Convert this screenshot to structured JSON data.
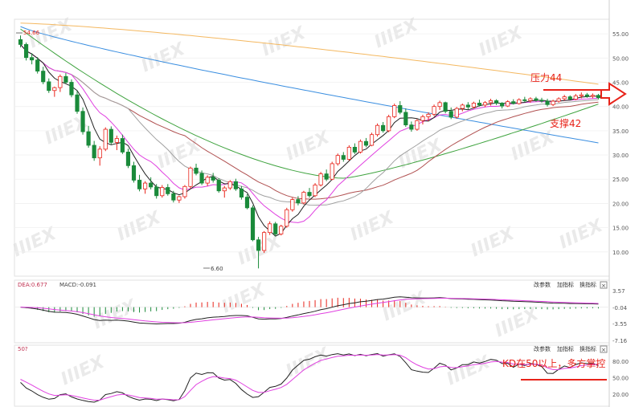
{
  "chart_data": [
    {
      "type": "candlestick",
      "ylim": [
        5,
        58
      ],
      "yticks": [
        "55.00",
        "50.00",
        "45.00",
        "40.00",
        "35.00",
        "30.00",
        "25.00",
        "20.00",
        "15.00",
        "10.00"
      ],
      "high_label": "54.66",
      "low_label": "6.60",
      "ohlc": [
        [
          53.8,
          54.66,
          52.2,
          52.8
        ],
        [
          52.8,
          53.2,
          49.5,
          50.1
        ],
        [
          50.1,
          51.0,
          48.7,
          49.6
        ],
        [
          49.6,
          50.2,
          46.8,
          47.3
        ],
        [
          47.3,
          48.2,
          44.6,
          45.1
        ],
        [
          45.1,
          45.8,
          42.8,
          43.3
        ],
        [
          43.3,
          44.1,
          42.0,
          43.9
        ],
        [
          43.9,
          46.6,
          43.0,
          46.2
        ],
        [
          46.2,
          46.9,
          44.7,
          45.0
        ],
        [
          45.0,
          45.6,
          41.9,
          42.4
        ],
        [
          42.4,
          43.2,
          38.5,
          39.0
        ],
        [
          39.0,
          39.8,
          34.2,
          34.8
        ],
        [
          34.8,
          36.0,
          31.5,
          32.0
        ],
        [
          32.0,
          32.9,
          28.8,
          29.4
        ],
        [
          29.4,
          31.8,
          27.8,
          31.2
        ],
        [
          31.2,
          35.7,
          30.8,
          35.3
        ],
        [
          35.3,
          35.9,
          32.2,
          32.6
        ],
        [
          32.6,
          34.0,
          31.0,
          33.4
        ],
        [
          33.4,
          34.2,
          30.2,
          30.6
        ],
        [
          30.6,
          31.3,
          27.3,
          27.8
        ],
        [
          27.8,
          28.6,
          24.3,
          24.8
        ],
        [
          24.8,
          25.9,
          22.5,
          23.0
        ],
        [
          23.0,
          24.6,
          22.0,
          24.2
        ],
        [
          24.2,
          25.4,
          22.9,
          23.4
        ],
        [
          23.4,
          24.0,
          21.0,
          21.6
        ],
        [
          21.6,
          23.8,
          21.2,
          23.3
        ],
        [
          23.3,
          24.0,
          21.6,
          22.0
        ],
        [
          22.0,
          22.6,
          20.2,
          20.7
        ],
        [
          20.7,
          21.6,
          20.1,
          21.4
        ],
        [
          21.4,
          23.8,
          21.0,
          23.5
        ],
        [
          23.5,
          27.6,
          23.1,
          27.3
        ],
        [
          27.3,
          28.2,
          25.8,
          26.2
        ],
        [
          26.2,
          26.8,
          23.8,
          24.2
        ],
        [
          24.2,
          25.8,
          23.6,
          25.4
        ],
        [
          25.4,
          26.3,
          24.3,
          24.8
        ],
        [
          24.8,
          25.2,
          22.2,
          22.6
        ],
        [
          22.6,
          23.6,
          21.2,
          23.2
        ],
        [
          23.2,
          24.8,
          22.8,
          24.5
        ],
        [
          24.5,
          25.1,
          22.6,
          23.0
        ],
        [
          23.0,
          23.6,
          20.8,
          21.3
        ],
        [
          21.3,
          21.9,
          18.8,
          19.1
        ],
        [
          19.1,
          19.6,
          12.2,
          12.5
        ],
        [
          12.5,
          13.1,
          6.6,
          10.3
        ],
        [
          10.3,
          14.3,
          9.8,
          14.0
        ],
        [
          14.0,
          16.3,
          13.5,
          15.8
        ],
        [
          15.8,
          16.2,
          13.2,
          13.7
        ],
        [
          13.7,
          15.6,
          13.4,
          15.3
        ],
        [
          15.3,
          19.1,
          15.0,
          18.7
        ],
        [
          18.7,
          21.2,
          18.3,
          20.8
        ],
        [
          20.8,
          21.5,
          19.6,
          20.1
        ],
        [
          20.1,
          22.6,
          19.8,
          22.3
        ],
        [
          22.3,
          23.2,
          21.2,
          21.6
        ],
        [
          21.6,
          24.2,
          21.3,
          23.8
        ],
        [
          23.8,
          26.5,
          23.5,
          26.1
        ],
        [
          26.1,
          27.0,
          24.6,
          25.0
        ],
        [
          25.0,
          28.6,
          24.8,
          28.2
        ],
        [
          28.2,
          30.3,
          27.8,
          29.9
        ],
        [
          29.9,
          30.6,
          28.6,
          29.1
        ],
        [
          29.1,
          32.0,
          28.8,
          31.6
        ],
        [
          31.6,
          32.4,
          30.2,
          30.6
        ],
        [
          30.6,
          33.2,
          30.3,
          32.8
        ],
        [
          32.8,
          33.5,
          31.6,
          32.0
        ],
        [
          32.0,
          34.6,
          31.8,
          34.2
        ],
        [
          34.2,
          36.5,
          33.8,
          36.1
        ],
        [
          36.1,
          36.8,
          34.6,
          35.0
        ],
        [
          35.0,
          38.3,
          34.7,
          37.9
        ],
        [
          37.9,
          40.6,
          37.6,
          40.2
        ],
        [
          40.2,
          41.1,
          38.4,
          38.8
        ],
        [
          38.8,
          39.6,
          35.8,
          36.2
        ],
        [
          36.2,
          36.9,
          34.8,
          35.3
        ],
        [
          35.3,
          37.4,
          35.0,
          37.1
        ],
        [
          37.1,
          38.3,
          36.3,
          37.9
        ],
        [
          37.9,
          38.8,
          37.0,
          38.4
        ],
        [
          38.4,
          40.4,
          38.0,
          40.0
        ],
        [
          40.0,
          41.2,
          39.3,
          40.8
        ],
        [
          40.8,
          41.0,
          38.6,
          39.0
        ],
        [
          39.0,
          39.8,
          37.4,
          37.8
        ],
        [
          37.8,
          39.9,
          37.5,
          39.6
        ],
        [
          39.6,
          40.6,
          39.0,
          40.3
        ],
        [
          40.3,
          40.9,
          39.4,
          39.9
        ],
        [
          39.9,
          41.0,
          39.6,
          40.7
        ],
        [
          40.7,
          41.4,
          40.0,
          40.3
        ],
        [
          40.3,
          41.1,
          39.9,
          40.8
        ],
        [
          40.8,
          41.6,
          40.2,
          41.2
        ],
        [
          41.2,
          41.5,
          40.3,
          40.7
        ],
        [
          40.7,
          40.9,
          39.6,
          40.1
        ],
        [
          40.1,
          41.3,
          39.9,
          41.0
        ],
        [
          41.0,
          41.5,
          40.4,
          40.6
        ],
        [
          40.6,
          41.7,
          40.4,
          41.4
        ],
        [
          41.4,
          42.0,
          40.9,
          41.2
        ],
        [
          41.2,
          41.9,
          40.8,
          41.6
        ],
        [
          41.6,
          42.0,
          41.0,
          41.3
        ],
        [
          41.3,
          41.8,
          40.8,
          41.1
        ],
        [
          41.1,
          41.6,
          40.0,
          40.4
        ],
        [
          40.4,
          41.4,
          40.1,
          41.1
        ],
        [
          41.1,
          41.9,
          40.8,
          41.6
        ],
        [
          41.6,
          42.4,
          41.2,
          42.0
        ],
        [
          42.0,
          42.3,
          41.3,
          41.5
        ],
        [
          41.5,
          42.6,
          41.3,
          42.2
        ],
        [
          42.2,
          42.9,
          41.7,
          42.4
        ],
        [
          42.4,
          42.8,
          41.8,
          42.1
        ],
        [
          42.1,
          42.7,
          41.7,
          42.3
        ],
        [
          42.3,
          42.6,
          41.5,
          41.8
        ]
      ]
    },
    {
      "type": "bar",
      "indicator": "MACD",
      "yticks": [
        "3.57",
        "-0.04",
        "-3.55",
        "-7.16"
      ],
      "ylim": [
        -7.16,
        3.57
      ],
      "dea_label": "DEA:0.677",
      "macd_label": "MACD:-0.091"
    },
    {
      "type": "line",
      "indicator": "KD",
      "yticks": [
        "80.00",
        "50.00",
        "20.00"
      ],
      "ylim": [
        0,
        100
      ],
      "k_label": "50?"
    }
  ],
  "annotations": {
    "resistance": "压力44",
    "support": "支撑42",
    "kd_note": "KD在50以上，多方掌控"
  },
  "buttons": {
    "params": "改参数",
    "add": "加指标",
    "swap": "换指标",
    "close": "×"
  },
  "watermark": "IIIEX",
  "colors": {
    "up": "#e8231a",
    "down": "#1a8a3a",
    "ma_orange": "#f4b860",
    "ma_blue": "#3a8ee0",
    "ma_green": "#3fa33f",
    "ma_brown": "#b05050",
    "ma_gray": "#a0a0a0",
    "ma_magenta": "#e040e0",
    "ma_black": "#222222"
  }
}
